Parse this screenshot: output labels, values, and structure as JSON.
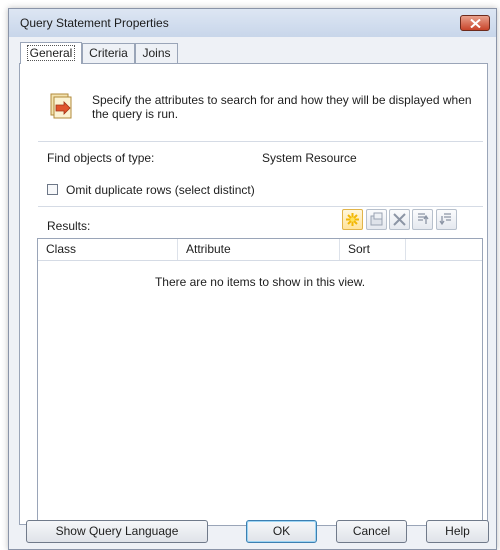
{
  "window": {
    "title": "Query Statement Properties"
  },
  "tabs": [
    {
      "label": "General",
      "active": true
    },
    {
      "label": "Criteria",
      "active": false
    },
    {
      "label": "Joins",
      "active": false
    }
  ],
  "info": {
    "text": "Specify the attributes to search for and how they will be displayed when the query is run."
  },
  "find_objects": {
    "label": "Find objects of type:",
    "value": "System Resource"
  },
  "omit_duplicates": {
    "label": "Omit duplicate rows (select distinct)",
    "checked": false
  },
  "results": {
    "label": "Results:",
    "columns": [
      "Class",
      "Attribute",
      "Sort"
    ],
    "empty_prefix": "There are no items",
    "empty_suffix": " to show in this view."
  },
  "toolbar": {
    "new_icon": "starburst-new-icon",
    "properties_icon": "properties-icon",
    "delete_icon": "delete-x-icon",
    "move_up_icon": "move-up-icon",
    "move_down_icon": "move-down-icon"
  },
  "buttons": {
    "show_query_language": "Show Query Language",
    "ok": "OK",
    "cancel": "Cancel",
    "help": "Help"
  },
  "colors": {
    "accent_default_button": "#3c7fb1",
    "close_button": "#c8442a"
  }
}
